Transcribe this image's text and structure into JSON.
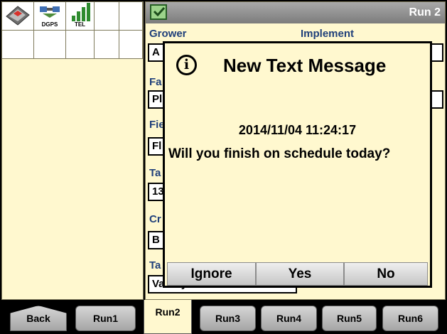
{
  "window": {
    "run_title": "Run 2"
  },
  "status_icons": [
    {
      "name": "gps-receiver-icon",
      "label": ""
    },
    {
      "name": "dgps-icon",
      "label": "DGPS"
    },
    {
      "name": "signal-bars-icon",
      "label": "TEL"
    }
  ],
  "fields": {
    "grower_label": "Grower",
    "grower_value": "A",
    "implement_label": "Implement",
    "farm_label": "Fa",
    "farm_value": "Pl",
    "field_label": "Fie",
    "field_value": "Fl",
    "task_label": "Ta",
    "task_value": "13",
    "crop_label": "Cr",
    "crop_value": "B",
    "tank_label": "Ta",
    "tank_value": "Variety A"
  },
  "dialog": {
    "title": "New Text Message",
    "timestamp": "2014/11/04 11:24:17",
    "message": "Will you finish on schedule today?",
    "ignore_label": "Ignore",
    "yes_label": "Yes",
    "no_label": "No"
  },
  "tabs": {
    "back": "Back",
    "run1": "Run1",
    "run2": "Run2",
    "run3": "Run3",
    "run4": "Run4",
    "run5": "Run5",
    "run6": "Run6",
    "active": "Run2"
  },
  "colors": {
    "panel_bg": "#fff8cf",
    "label_blue": "#1f3f7a",
    "title_bar_gray": "#8c8c8c"
  }
}
